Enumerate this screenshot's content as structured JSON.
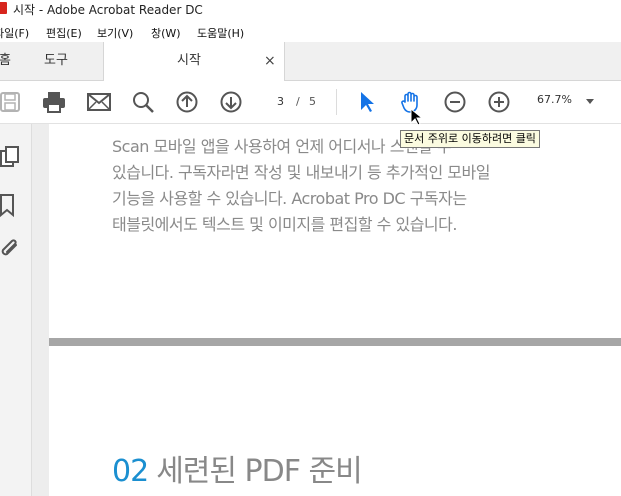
{
  "window": {
    "title": "시작 - Adobe Acrobat Reader DC"
  },
  "menu": [
    {
      "label": "파일(F)"
    },
    {
      "label": "편집(E)"
    },
    {
      "label": "보기(V)"
    },
    {
      "label": "창(W)"
    },
    {
      "label": "도움말(H)"
    }
  ],
  "tabs": {
    "home": "홈",
    "tools": "도구",
    "active": "시작",
    "close": "×"
  },
  "toolbar": {
    "page_current": "3",
    "page_separator": "/",
    "page_total": "5",
    "zoom": "67.7%",
    "icons": [
      "save-icon",
      "print-icon",
      "email-icon",
      "search-icon",
      "prev-page-icon",
      "next-page-icon",
      "select-tool-icon",
      "hand-tool-icon",
      "zoom-out-icon",
      "zoom-in-icon"
    ],
    "accent_color": "#1473e6"
  },
  "tooltip": "문서 주위로 이동하려면 클릭",
  "document": {
    "paragraph_lines": [
      "Scan 모바일 앱을 사용하여 언제 어디서나 스캔할 수",
      "있습니다. 구독자라면 작성 및 내보내기 등 추가적인 모바일",
      "기능을 사용할 수 있습니다. Acrobat Pro DC 구독자는",
      "태블릿에서도 텍스트 및 이미지를 편집할 수 있습니다."
    ],
    "heading_number": "02",
    "heading_text": "세련된 PDF 준비",
    "heading_number_color": "#1b8fd0"
  }
}
